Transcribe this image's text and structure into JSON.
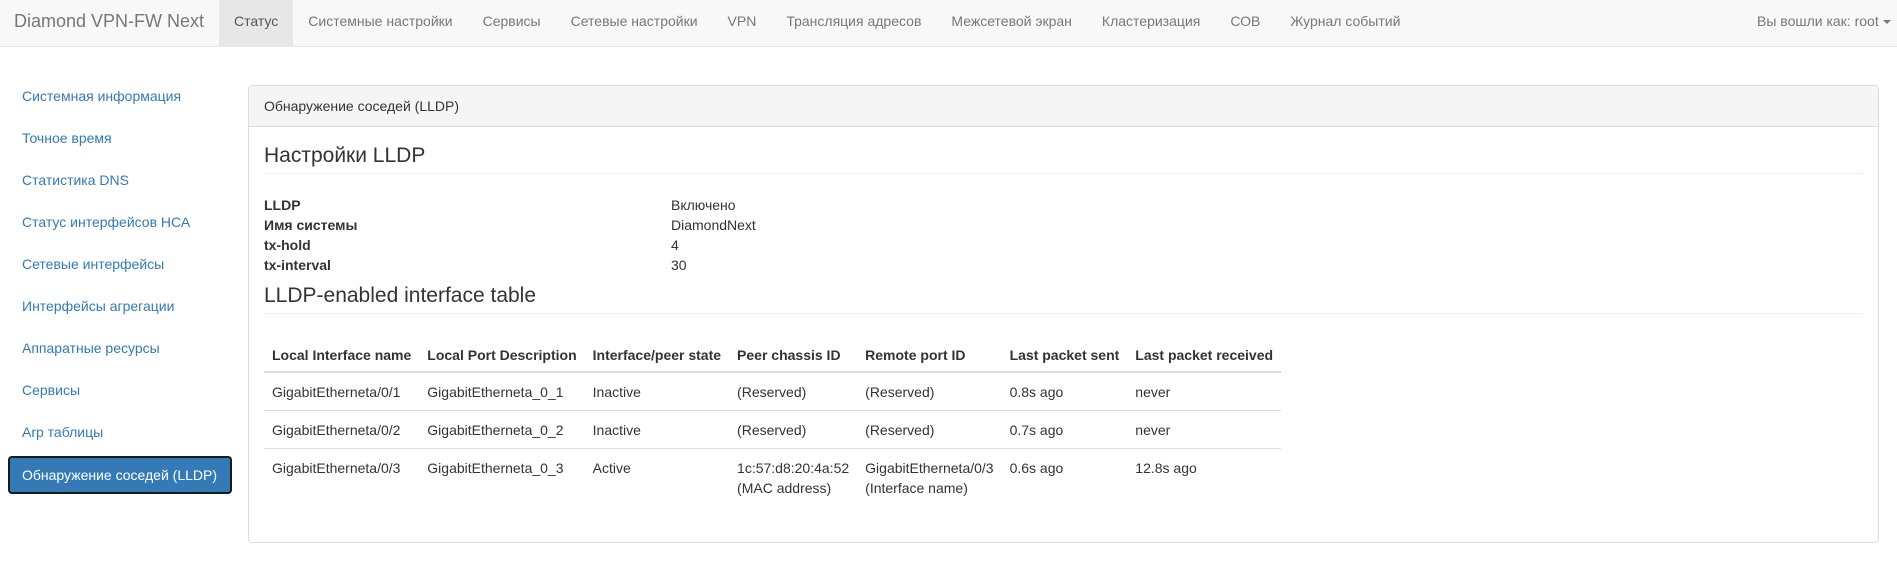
{
  "navbar": {
    "brand": "Diamond VPN-FW Next",
    "items": [
      {
        "label": "Статус",
        "active": true
      },
      {
        "label": "Системные настройки"
      },
      {
        "label": "Сервисы"
      },
      {
        "label": "Сетевые настройки"
      },
      {
        "label": "VPN"
      },
      {
        "label": "Трансляция адресов"
      },
      {
        "label": "Межсетевой экран"
      },
      {
        "label": "Кластеризация"
      },
      {
        "label": "СОВ"
      },
      {
        "label": "Журнал событий"
      }
    ],
    "user": "Вы вошли как: root"
  },
  "sidebar": {
    "items": [
      {
        "label": "Системная информация"
      },
      {
        "label": "Точное время"
      },
      {
        "label": "Статистика DNS"
      },
      {
        "label": "Статус интерфейсов НСА"
      },
      {
        "label": "Сетевые интерфейсы"
      },
      {
        "label": "Интерфейсы агрегации"
      },
      {
        "label": "Аппаратные ресурсы"
      },
      {
        "label": "Сервисы"
      },
      {
        "label": "Arp таблицы"
      },
      {
        "label": "Обнаружение соседей (LLDP)",
        "active": true
      }
    ]
  },
  "panel": {
    "heading": "Обнаружение соседей (LLDP)",
    "settings_title": "Настройки LLDP",
    "settings": [
      {
        "key": "LLDP",
        "value": "Включено"
      },
      {
        "key": "Имя системы",
        "value": "DiamondNext"
      },
      {
        "key": "tx-hold",
        "value": "4"
      },
      {
        "key": "tx-interval",
        "value": "30"
      }
    ],
    "table_title": "LLDP-enabled interface table",
    "table": {
      "columns": [
        "Local Interface name",
        "Local Port Description",
        "Interface/peer state",
        "Peer chassis ID",
        "Remote port ID",
        "Last packet sent",
        "Last packet received"
      ],
      "rows": [
        [
          "GigabitEtherneta/0/1",
          "GigabitEtherneta_0_1",
          "Inactive",
          [
            "(Reserved)"
          ],
          [
            "(Reserved)"
          ],
          "0.8s ago",
          "never"
        ],
        [
          "GigabitEtherneta/0/2",
          "GigabitEtherneta_0_2",
          "Inactive",
          [
            "(Reserved)"
          ],
          [
            "(Reserved)"
          ],
          "0.7s ago",
          "never"
        ],
        [
          "GigabitEtherneta/0/3",
          "GigabitEtherneta_0_3",
          "Active",
          [
            "1c:57:d8:20:4a:52",
            "(MAC address)"
          ],
          [
            "GigabitEtherneta/0/3",
            "(Interface name)"
          ],
          "0.6s ago",
          "12.8s ago"
        ]
      ]
    }
  }
}
